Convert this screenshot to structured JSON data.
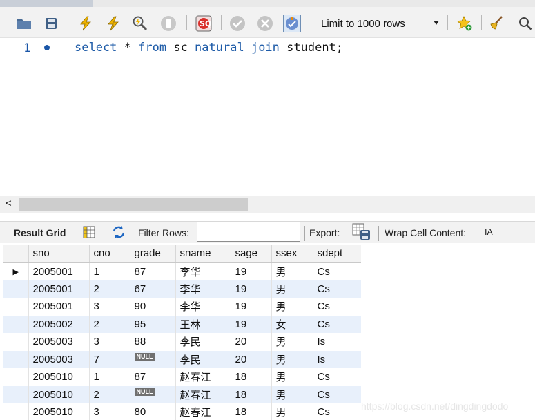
{
  "toolbar": {
    "limit_label": "Limit to 1000 rows"
  },
  "editor": {
    "line_number": "1",
    "sql_tokens": {
      "select": "select",
      "star": " * ",
      "from": "from",
      "table1": " sc ",
      "natural": "natural",
      "sp": " ",
      "join": "join",
      "rest": " student;"
    }
  },
  "scrollbar": {
    "left_arrow": "<"
  },
  "result_toolbar": {
    "result_grid": "Result Grid",
    "filter_rows": "Filter Rows:",
    "filter_value": "",
    "export": "Export:",
    "wrap_cell_content": "Wrap Cell Content:",
    "wrap_icon_glyph": "IA"
  },
  "grid": {
    "columns": [
      "sno",
      "cno",
      "grade",
      "sname",
      "sage",
      "ssex",
      "sdept"
    ],
    "rows": [
      [
        "2005001",
        "1",
        "87",
        "李华",
        "19",
        "男",
        "Cs"
      ],
      [
        "2005001",
        "2",
        "67",
        "李华",
        "19",
        "男",
        "Cs"
      ],
      [
        "2005001",
        "3",
        "90",
        "李华",
        "19",
        "男",
        "Cs"
      ],
      [
        "2005002",
        "2",
        "95",
        "王林",
        "19",
        "女",
        "Cs"
      ],
      [
        "2005003",
        "3",
        "88",
        "李民",
        "20",
        "男",
        "Is"
      ],
      [
        "2005003",
        "7",
        "NULL",
        "李民",
        "20",
        "男",
        "Is"
      ],
      [
        "2005010",
        "1",
        "87",
        "赵春江",
        "18",
        "男",
        "Cs"
      ],
      [
        "2005010",
        "2",
        "NULL",
        "赵春江",
        "18",
        "男",
        "Cs"
      ],
      [
        "2005010",
        "3",
        "80",
        "赵春江",
        "18",
        "男",
        "Cs"
      ]
    ],
    "current_row_marker": "▶"
  },
  "watermark": "https://blog.csdn.net/dingdingdodo",
  "colors": {
    "keyword": "#1f5ca8",
    "row_alt": "#e8f0fb",
    "toolbar_bg": "#f2f2f2"
  }
}
